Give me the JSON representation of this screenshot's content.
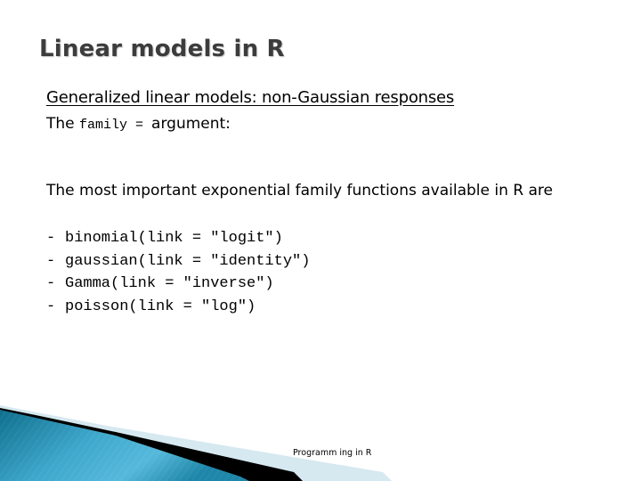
{
  "slide": {
    "title": "Linear models in R",
    "subheading": "Generalized linear models: non-Gaussian responses",
    "family_line": {
      "prefix": "The ",
      "code": "family = ",
      "suffix": "argument:"
    },
    "intro": "The most important exponential family functions available in R are",
    "list_bullet": "-",
    "families": [
      "binomial(link = \"logit\")",
      "gaussian(link = \"identity\")",
      "Gamma(link = \"inverse\")",
      "poisson(link = \"log\")"
    ],
    "footer": "Programm ing in R"
  },
  "colors": {
    "title": "#3c3c3c",
    "wedge_dark": "#0e6f8c",
    "wedge_light": "#4cb4d6",
    "band_light": "#d6e9f0",
    "band_black": "#000000"
  }
}
